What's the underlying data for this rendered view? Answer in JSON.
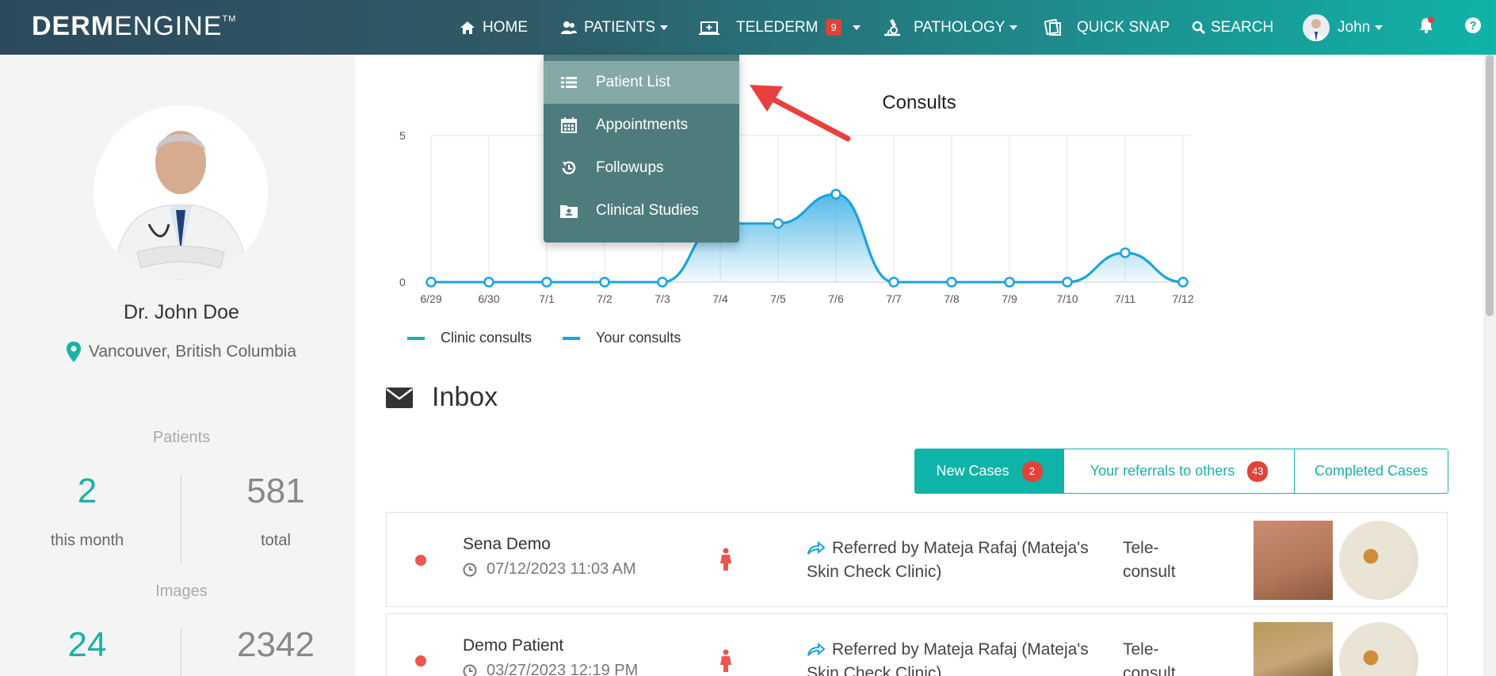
{
  "nav": {
    "logo_bold": "DERM",
    "logo_light": "ENGINE",
    "logo_tm": "TM",
    "items": [
      {
        "label": "HOME",
        "icon": "home-icon"
      },
      {
        "label": "PATIENTS",
        "icon": "users-icon"
      },
      {
        "label": "TELEDERM",
        "icon": "telederm-icon",
        "badge": "9"
      },
      {
        "label": "PATHOLOGY",
        "icon": "microscope-icon"
      },
      {
        "label": "QUICK SNAP",
        "icon": "quicksnap-icon"
      },
      {
        "label": "SEARCH",
        "icon": "search-icon"
      },
      {
        "label": "John",
        "icon": "avatar"
      }
    ]
  },
  "dropdown": {
    "items": [
      {
        "label": "Patient List",
        "icon": "list-icon"
      },
      {
        "label": "Appointments",
        "icon": "calendar-icon"
      },
      {
        "label": "Followups",
        "icon": "followup-icon"
      },
      {
        "label": "Clinical Studies",
        "icon": "folder-user-icon"
      }
    ]
  },
  "profile": {
    "name": "Dr. John Doe",
    "location": "Vancouver, British Columbia"
  },
  "stats": {
    "patients_title": "Patients",
    "patients_month": "2",
    "patients_month_label": "this month",
    "patients_total": "581",
    "patients_total_label": "total",
    "images_title": "Images",
    "images_month": "24",
    "images_total": "2342"
  },
  "chart_data": {
    "type": "area",
    "title": "Consults",
    "categories": [
      "6/29",
      "6/30",
      "7/1",
      "7/2",
      "7/3",
      "7/4",
      "7/5",
      "7/6",
      "7/7",
      "7/8",
      "7/9",
      "7/10",
      "7/11",
      "7/12"
    ],
    "y_ticks": [
      "5",
      "0"
    ],
    "ylim": [
      0,
      5
    ],
    "grid": true,
    "legend_placement": "bottom-left",
    "series": [
      {
        "name": "Clinic consults",
        "color": "#19b3a4",
        "values": [
          0,
          0,
          0,
          0,
          0,
          2,
          2,
          3,
          0,
          0,
          0,
          0,
          1,
          0
        ]
      },
      {
        "name": "Your consults",
        "color": "#1aa3e0",
        "values": [
          0,
          0,
          0,
          0,
          0,
          2,
          2,
          3,
          0,
          0,
          0,
          0,
          1,
          0
        ]
      }
    ]
  },
  "inbox": {
    "title": "Inbox",
    "tabs": [
      {
        "label": "New Cases",
        "count": "2"
      },
      {
        "label": "Your referrals to others",
        "count": "43"
      },
      {
        "label": "Completed Cases",
        "count": ""
      }
    ],
    "cases": [
      {
        "name": "Sena Demo",
        "date": "07/12/2023 11:03 AM",
        "referral": "Referred by Mateja Rafaj (Mateja's Skin Check Clinic)",
        "type": "Tele-consult"
      },
      {
        "name": "Demo Patient",
        "date": "03/27/2023 12:19 PM",
        "referral": "Referred by Mateja Rafaj (Mateja's Skin Check Clinic)",
        "type": "Tele-consult"
      }
    ]
  }
}
